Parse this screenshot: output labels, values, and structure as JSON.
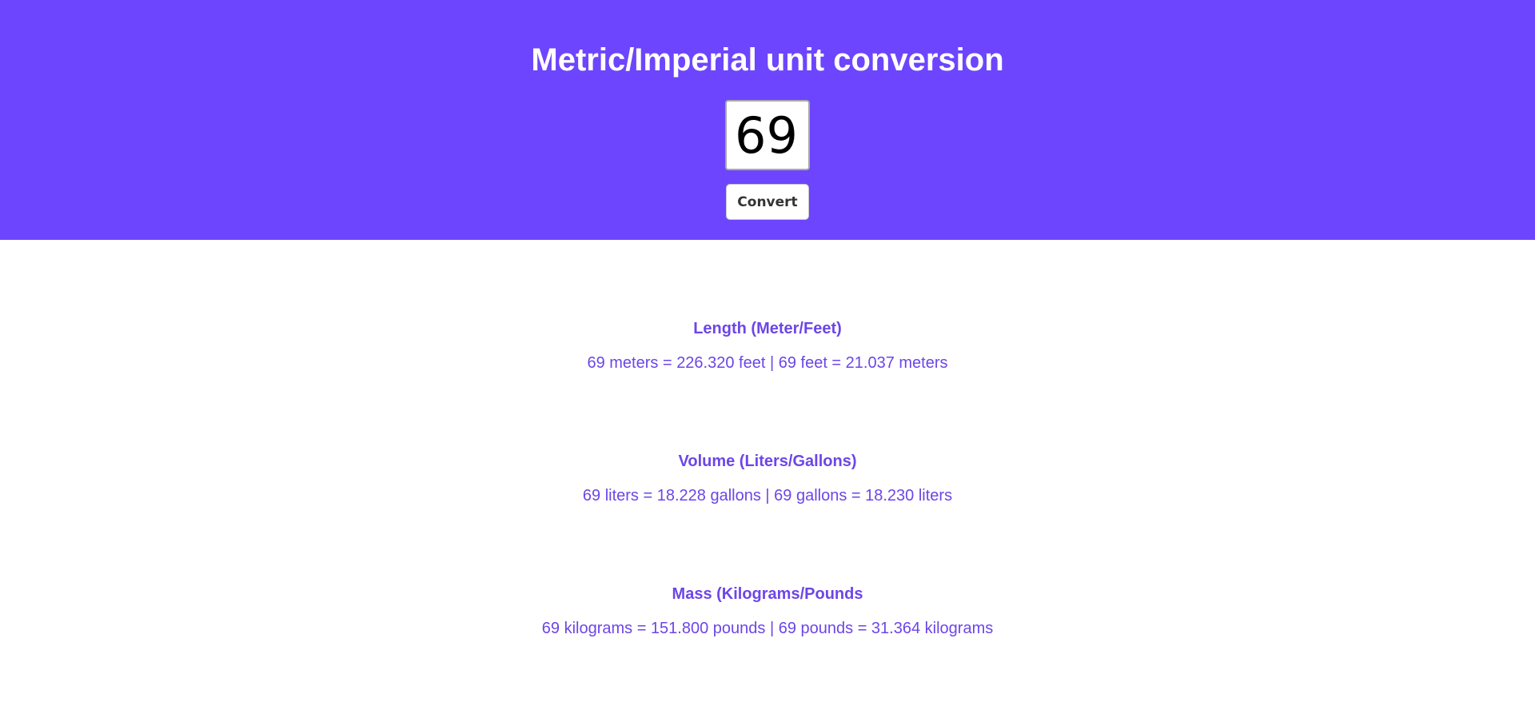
{
  "header": {
    "title": "Metric/Imperial unit conversion",
    "input_value": "69",
    "convert_label": "Convert"
  },
  "results": [
    {
      "heading": "Length (Meter/Feet)",
      "text": "69 meters = 226.320 feet | 69 feet = 21.037 meters"
    },
    {
      "heading": "Volume (Liters/Gallons)",
      "text": "69 liters = 18.228 gallons | 69 gallons = 18.230 liters"
    },
    {
      "heading": "Mass (Kilograms/Pounds",
      "text": "69 kilograms = 151.800 pounds | 69 pounds = 31.364 kilograms"
    }
  ],
  "colors": {
    "header_background": "#6d45fe",
    "result_text": "#6d45e8"
  }
}
